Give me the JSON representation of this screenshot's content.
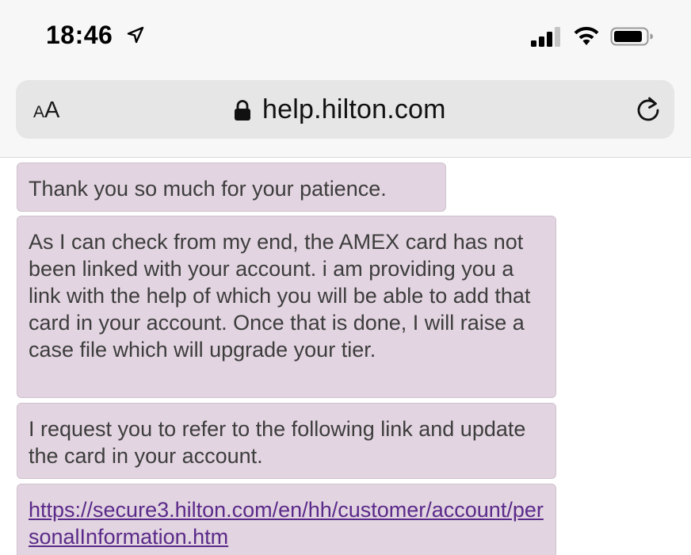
{
  "status_bar": {
    "time": "18:46",
    "location_icon": "location-arrow-icon",
    "signal_icon": "cellular-signal-icon",
    "wifi_icon": "wifi-icon",
    "battery_icon": "battery-icon"
  },
  "browser": {
    "text_size_small": "A",
    "text_size_large": "A",
    "url": "help.hilton.com",
    "lock_icon": "lock-icon",
    "reload_icon": "reload-icon"
  },
  "chat": {
    "messages": [
      {
        "text": "Thank you so much for your patience."
      },
      {
        "text": "As I can check from my end, the AMEX card has not been linked with your account. i am providing you a link with the help of which you will be able to add that card in your account. Once that is done, I will raise a case file which will upgrade your tier."
      },
      {
        "text": "I request you to refer to the following link and update the card in your account."
      },
      {
        "link": "https://secure3.hilton.com/en/hh/customer/account/personalInformation.htm"
      }
    ]
  },
  "colors": {
    "bubble_bg": "#e2d4e0",
    "link": "#5a2a8a",
    "chrome_bg": "#f7f7f7",
    "url_bar_bg": "#e6e6e6"
  }
}
